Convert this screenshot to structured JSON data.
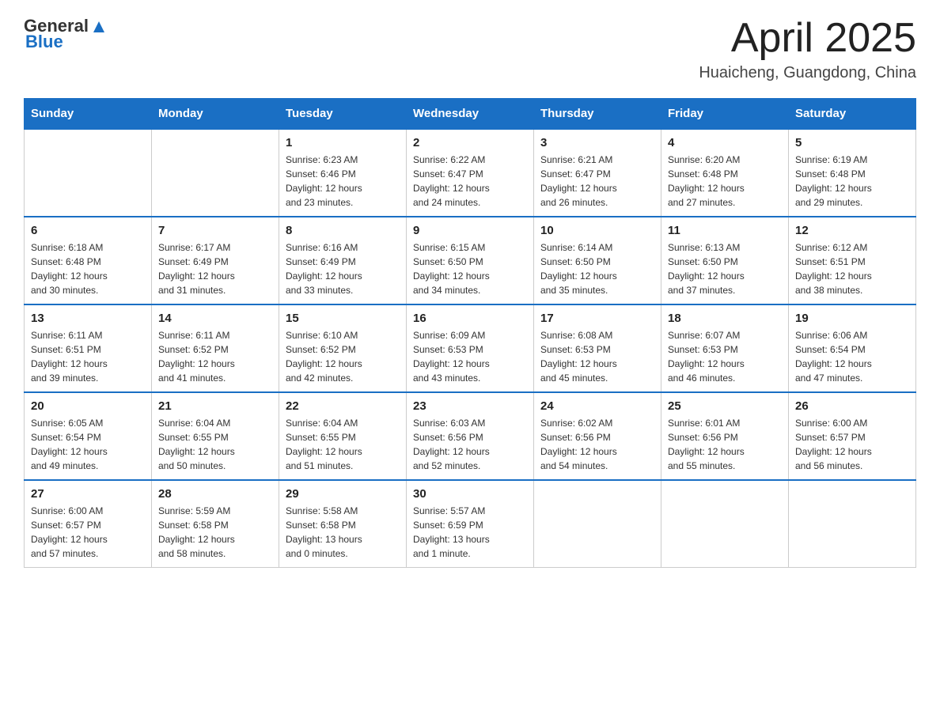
{
  "header": {
    "logo": {
      "text_general": "General",
      "text_blue": "Blue"
    },
    "title": "April 2025",
    "subtitle": "Huaicheng, Guangdong, China"
  },
  "weekdays": [
    "Sunday",
    "Monday",
    "Tuesday",
    "Wednesday",
    "Thursday",
    "Friday",
    "Saturday"
  ],
  "weeks": [
    [
      {
        "day": "",
        "info": ""
      },
      {
        "day": "",
        "info": ""
      },
      {
        "day": "1",
        "info": "Sunrise: 6:23 AM\nSunset: 6:46 PM\nDaylight: 12 hours\nand 23 minutes."
      },
      {
        "day": "2",
        "info": "Sunrise: 6:22 AM\nSunset: 6:47 PM\nDaylight: 12 hours\nand 24 minutes."
      },
      {
        "day": "3",
        "info": "Sunrise: 6:21 AM\nSunset: 6:47 PM\nDaylight: 12 hours\nand 26 minutes."
      },
      {
        "day": "4",
        "info": "Sunrise: 6:20 AM\nSunset: 6:48 PM\nDaylight: 12 hours\nand 27 minutes."
      },
      {
        "day": "5",
        "info": "Sunrise: 6:19 AM\nSunset: 6:48 PM\nDaylight: 12 hours\nand 29 minutes."
      }
    ],
    [
      {
        "day": "6",
        "info": "Sunrise: 6:18 AM\nSunset: 6:48 PM\nDaylight: 12 hours\nand 30 minutes."
      },
      {
        "day": "7",
        "info": "Sunrise: 6:17 AM\nSunset: 6:49 PM\nDaylight: 12 hours\nand 31 minutes."
      },
      {
        "day": "8",
        "info": "Sunrise: 6:16 AM\nSunset: 6:49 PM\nDaylight: 12 hours\nand 33 minutes."
      },
      {
        "day": "9",
        "info": "Sunrise: 6:15 AM\nSunset: 6:50 PM\nDaylight: 12 hours\nand 34 minutes."
      },
      {
        "day": "10",
        "info": "Sunrise: 6:14 AM\nSunset: 6:50 PM\nDaylight: 12 hours\nand 35 minutes."
      },
      {
        "day": "11",
        "info": "Sunrise: 6:13 AM\nSunset: 6:50 PM\nDaylight: 12 hours\nand 37 minutes."
      },
      {
        "day": "12",
        "info": "Sunrise: 6:12 AM\nSunset: 6:51 PM\nDaylight: 12 hours\nand 38 minutes."
      }
    ],
    [
      {
        "day": "13",
        "info": "Sunrise: 6:11 AM\nSunset: 6:51 PM\nDaylight: 12 hours\nand 39 minutes."
      },
      {
        "day": "14",
        "info": "Sunrise: 6:11 AM\nSunset: 6:52 PM\nDaylight: 12 hours\nand 41 minutes."
      },
      {
        "day": "15",
        "info": "Sunrise: 6:10 AM\nSunset: 6:52 PM\nDaylight: 12 hours\nand 42 minutes."
      },
      {
        "day": "16",
        "info": "Sunrise: 6:09 AM\nSunset: 6:53 PM\nDaylight: 12 hours\nand 43 minutes."
      },
      {
        "day": "17",
        "info": "Sunrise: 6:08 AM\nSunset: 6:53 PM\nDaylight: 12 hours\nand 45 minutes."
      },
      {
        "day": "18",
        "info": "Sunrise: 6:07 AM\nSunset: 6:53 PM\nDaylight: 12 hours\nand 46 minutes."
      },
      {
        "day": "19",
        "info": "Sunrise: 6:06 AM\nSunset: 6:54 PM\nDaylight: 12 hours\nand 47 minutes."
      }
    ],
    [
      {
        "day": "20",
        "info": "Sunrise: 6:05 AM\nSunset: 6:54 PM\nDaylight: 12 hours\nand 49 minutes."
      },
      {
        "day": "21",
        "info": "Sunrise: 6:04 AM\nSunset: 6:55 PM\nDaylight: 12 hours\nand 50 minutes."
      },
      {
        "day": "22",
        "info": "Sunrise: 6:04 AM\nSunset: 6:55 PM\nDaylight: 12 hours\nand 51 minutes."
      },
      {
        "day": "23",
        "info": "Sunrise: 6:03 AM\nSunset: 6:56 PM\nDaylight: 12 hours\nand 52 minutes."
      },
      {
        "day": "24",
        "info": "Sunrise: 6:02 AM\nSunset: 6:56 PM\nDaylight: 12 hours\nand 54 minutes."
      },
      {
        "day": "25",
        "info": "Sunrise: 6:01 AM\nSunset: 6:56 PM\nDaylight: 12 hours\nand 55 minutes."
      },
      {
        "day": "26",
        "info": "Sunrise: 6:00 AM\nSunset: 6:57 PM\nDaylight: 12 hours\nand 56 minutes."
      }
    ],
    [
      {
        "day": "27",
        "info": "Sunrise: 6:00 AM\nSunset: 6:57 PM\nDaylight: 12 hours\nand 57 minutes."
      },
      {
        "day": "28",
        "info": "Sunrise: 5:59 AM\nSunset: 6:58 PM\nDaylight: 12 hours\nand 58 minutes."
      },
      {
        "day": "29",
        "info": "Sunrise: 5:58 AM\nSunset: 6:58 PM\nDaylight: 13 hours\nand 0 minutes."
      },
      {
        "day": "30",
        "info": "Sunrise: 5:57 AM\nSunset: 6:59 PM\nDaylight: 13 hours\nand 1 minute."
      },
      {
        "day": "",
        "info": ""
      },
      {
        "day": "",
        "info": ""
      },
      {
        "day": "",
        "info": ""
      }
    ]
  ]
}
